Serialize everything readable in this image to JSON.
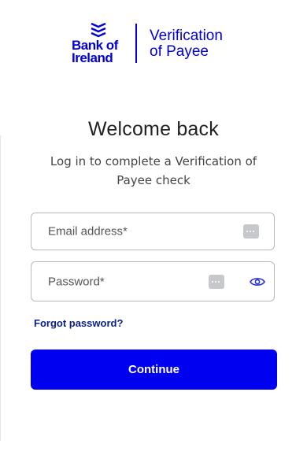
{
  "header": {
    "brand_line1": "Bank of",
    "brand_line2": "Ireland",
    "service_line1": "Verification",
    "service_line2": "of Payee",
    "brand_color": "#0000d7"
  },
  "main": {
    "title": "Welcome back",
    "subtitle": "Log in to complete a Verification of Payee check"
  },
  "form": {
    "email_label": "Email address*",
    "password_label": "Password*",
    "forgot_label": "Forgot password?",
    "continue_label": "Continue",
    "key_icon": "password-manager-key-icon",
    "eye_icon": "eye-icon",
    "button_color": "#0000f0"
  }
}
